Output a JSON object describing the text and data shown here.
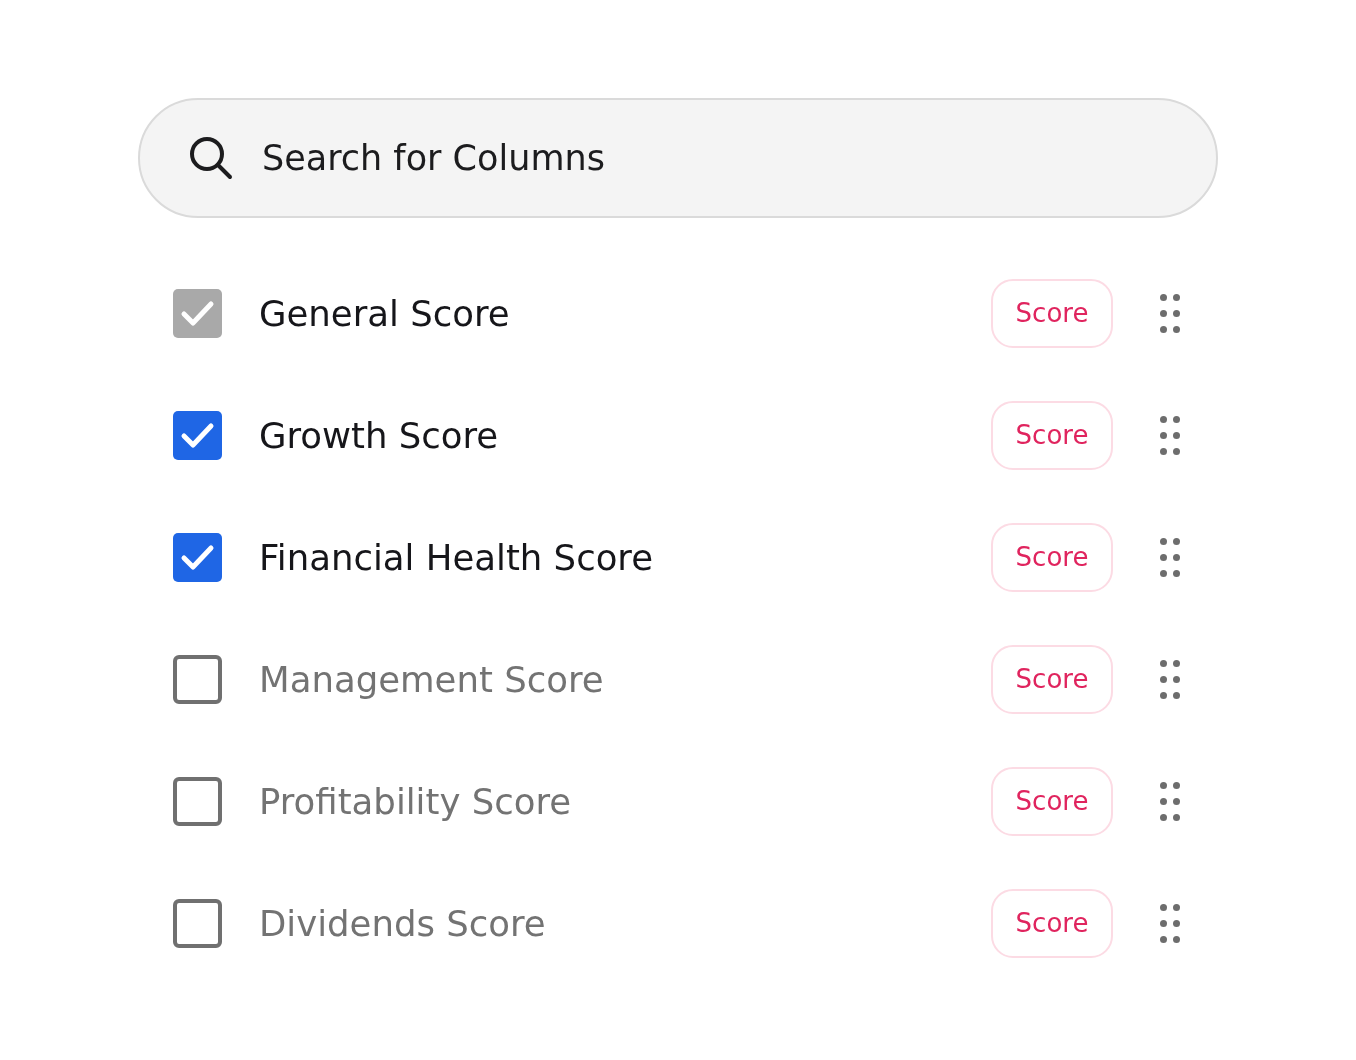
{
  "search": {
    "placeholder": "Search for Columns"
  },
  "columns": [
    {
      "label": "General Score",
      "checked": true,
      "disabled": true,
      "tag": "Score"
    },
    {
      "label": "Growth Score",
      "checked": true,
      "disabled": false,
      "tag": "Score"
    },
    {
      "label": "Financial Health Score",
      "checked": true,
      "disabled": false,
      "tag": "Score"
    },
    {
      "label": "Management Score",
      "checked": false,
      "disabled": false,
      "tag": "Score"
    },
    {
      "label": "Profitability Score",
      "checked": false,
      "disabled": false,
      "tag": "Score"
    },
    {
      "label": "Dividends Score",
      "checked": false,
      "disabled": false,
      "tag": "Score"
    }
  ]
}
